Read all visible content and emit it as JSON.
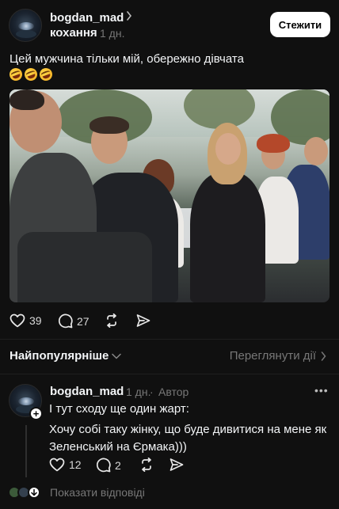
{
  "post": {
    "username": "bogdan_mad",
    "community": "кохання",
    "time": "1 дн.",
    "follow_label": "Стежити",
    "text": "Цей мужчина тільки мій, обережно дівчата",
    "emoji": [
      "rolling-on-floor-laughing",
      "rolling-on-floor-laughing",
      "rolling-on-floor-laughing"
    ],
    "likes": "39",
    "comments": "27"
  },
  "thread": {
    "sort_label": "Найпопулярніше",
    "activity_label": "Переглянути дії"
  },
  "reply": {
    "username": "bogdan_mad",
    "time": "1 дн.",
    "author_tag": "Автор",
    "line1": "І тут сходу ще один жарт:",
    "line2": "Хочу собі таку жінку, що буде дивитися на мене як Зеленський на Єрмака)))",
    "likes": "12",
    "comments": "2",
    "show_replies_label": "Показати відповіді"
  },
  "colors": {
    "background": "#101010",
    "text": "#f3f5f7",
    "muted": "#777777",
    "button_bg": "#ffffff"
  }
}
